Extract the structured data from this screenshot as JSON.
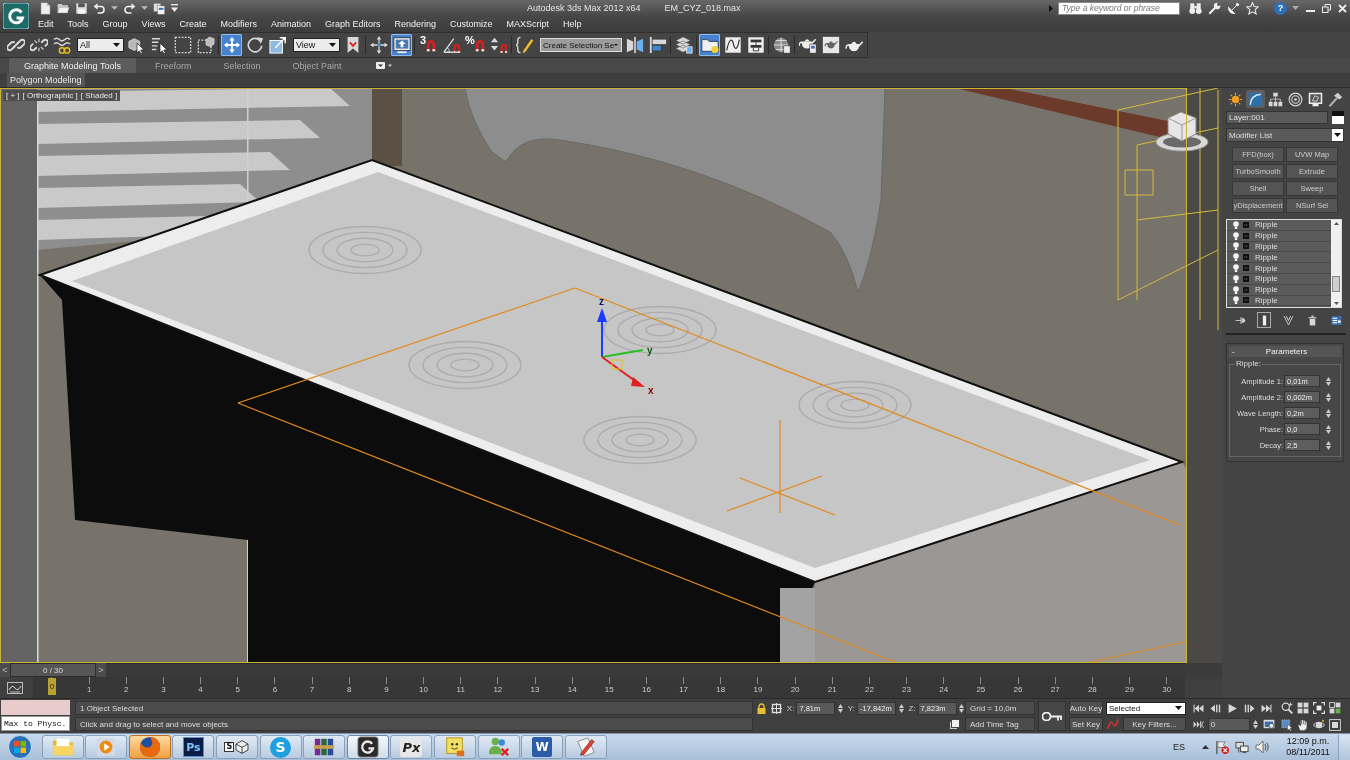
{
  "title_bar": {
    "title": "Autodesk 3ds Max 2012 x64",
    "file_name": "EM_CYZ_018.max",
    "search": {
      "placeholder": "Type a keyword or phrase"
    },
    "help": "?"
  },
  "menu_bar": [
    "Edit",
    "Tools",
    "Group",
    "Views",
    "Create",
    "Modifiers",
    "Animation",
    "Graph Editors",
    "Rendering",
    "Customize",
    "MAXScript",
    "Help"
  ],
  "main_toolbar": [
    {
      "kind": "button",
      "selected": false
    },
    {
      "kind": "button",
      "selected": false
    },
    {
      "kind": "button",
      "selected": false
    },
    {
      "kind": "dropdown",
      "value": "All"
    },
    {
      "kind": "button",
      "selected": false
    },
    {
      "kind": "button",
      "selected": false
    },
    {
      "kind": "button",
      "selected": false
    },
    {
      "kind": "button",
      "selected": false
    },
    {
      "kind": "separator"
    },
    {
      "kind": "button",
      "selected": true
    },
    {
      "kind": "button",
      "selected": false
    },
    {
      "kind": "button",
      "selected": false
    },
    {
      "kind": "dropdown",
      "value": "View"
    },
    {
      "kind": "button",
      "selected": false
    },
    {
      "kind": "separator"
    },
    {
      "kind": "button",
      "selected": false
    },
    {
      "kind": "button",
      "selected": true
    },
    {
      "kind": "separator"
    },
    {
      "kind": "button",
      "selected": false,
      "glyph": "3"
    },
    {
      "kind": "button",
      "selected": false
    },
    {
      "kind": "button",
      "selected": false,
      "glyph": "%"
    },
    {
      "kind": "button",
      "selected": false
    },
    {
      "kind": "separator"
    },
    {
      "kind": "button",
      "selected": false
    },
    {
      "kind": "dropdown",
      "value": "Create Selection Se"
    },
    {
      "kind": "button",
      "selected": false
    },
    {
      "kind": "button",
      "selected": false
    },
    {
      "kind": "separator"
    },
    {
      "kind": "button",
      "selected": false
    },
    {
      "kind": "separator"
    },
    {
      "kind": "button",
      "selected": true
    },
    {
      "kind": "button",
      "selected": false
    },
    {
      "kind": "button",
      "selected": false
    },
    {
      "kind": "separator"
    },
    {
      "kind": "button",
      "selected": false
    },
    {
      "kind": "separator"
    },
    {
      "kind": "button",
      "selected": false
    },
    {
      "kind": "button",
      "selected": false
    },
    {
      "kind": "button",
      "selected": false
    }
  ],
  "ribbon": {
    "tabs": [
      {
        "label": "Graphite Modeling Tools",
        "selected": true
      },
      {
        "label": "Freeform",
        "selected": false
      },
      {
        "label": "Selection",
        "selected": false
      },
      {
        "label": "Object Paint",
        "selected": false
      }
    ],
    "panels": [
      "Polygon Modeling"
    ]
  },
  "viewport": {
    "labels": [
      "[ + ]",
      "[ Orthographic ]",
      "[ Shaded ]"
    ],
    "gizmo_axes": [
      "z",
      "y",
      "x"
    ]
  },
  "command_panel": {
    "tabs": [
      {
        "selected": false
      },
      {
        "selected": true
      },
      {
        "selected": false
      },
      {
        "selected": false
      },
      {
        "selected": false
      },
      {
        "selected": false
      }
    ],
    "object_name": "Layer:001",
    "modifier_list": "Modifier List",
    "modifier_buttons": [
      "FFD(box)",
      "UVW Map",
      "TurboSmooth",
      "Extrude",
      "Shell",
      "Sweep",
      "yDisplacement",
      "NSurf Sel"
    ],
    "stack": [
      {
        "name": "Ripple",
        "on": true
      },
      {
        "name": "Ripple",
        "on": true
      },
      {
        "name": "Ripple",
        "on": true
      },
      {
        "name": "Ripple",
        "on": true
      },
      {
        "name": "Ripple",
        "on": true
      },
      {
        "name": "Ripple",
        "on": true
      },
      {
        "name": "Ripple",
        "on": true
      },
      {
        "name": "Ripple",
        "on": true
      }
    ],
    "stack_tools": [
      {
        "selected": false
      },
      {
        "selected": true
      },
      {
        "selected": false
      },
      {
        "selected": false
      },
      {
        "selected": false
      }
    ],
    "rollout": {
      "toggle": "-",
      "title": "Parameters",
      "group": "Ripple:",
      "params": [
        {
          "label": "Amplitude 1:",
          "value": "0,01m"
        },
        {
          "label": "Amplitude 2:",
          "value": "0,002m"
        },
        {
          "label": "Wave Length:",
          "value": "0,2m"
        },
        {
          "label": "Phase:",
          "value": "0,0"
        },
        {
          "label": "Decay:",
          "value": "2,5"
        }
      ]
    }
  },
  "time_slider": {
    "prev": "<",
    "label": "0 / 30",
    "next": ">"
  },
  "track_bar": {
    "ticks": [
      {
        "label": "0",
        "selected": true
      },
      {
        "label": "1",
        "selected": false
      },
      {
        "label": "2",
        "selected": false
      },
      {
        "label": "3",
        "selected": false
      },
      {
        "label": "4",
        "selected": false
      },
      {
        "label": "5",
        "selected": false
      },
      {
        "label": "6",
        "selected": false
      },
      {
        "label": "7",
        "selected": false
      },
      {
        "label": "8",
        "selected": false
      },
      {
        "label": "9",
        "selected": false
      },
      {
        "label": "10",
        "selected": false
      },
      {
        "label": "11",
        "selected": false
      },
      {
        "label": "12",
        "selected": false
      },
      {
        "label": "13",
        "selected": false
      },
      {
        "label": "14",
        "selected": false
      },
      {
        "label": "15",
        "selected": false
      },
      {
        "label": "16",
        "selected": false
      },
      {
        "label": "17",
        "selected": false
      },
      {
        "label": "18",
        "selected": false
      },
      {
        "label": "19",
        "selected": false
      },
      {
        "label": "20",
        "selected": false
      },
      {
        "label": "21",
        "selected": false
      },
      {
        "label": "22",
        "selected": false
      },
      {
        "label": "23",
        "selected": false
      },
      {
        "label": "24",
        "selected": false
      },
      {
        "label": "25",
        "selected": false
      },
      {
        "label": "26",
        "selected": false
      },
      {
        "label": "27",
        "selected": false
      },
      {
        "label": "28",
        "selected": false
      },
      {
        "label": "29",
        "selected": false
      },
      {
        "label": "30",
        "selected": false
      }
    ]
  },
  "status_bar": {
    "listener_output": "Max to Physc.",
    "selection": "1 Object Selected",
    "prompt": "Click and drag to select and move objects",
    "coordinates": [
      {
        "axis": "X:",
        "value": "7,81m"
      },
      {
        "axis": "Y:",
        "value": "-17,842m"
      },
      {
        "axis": "Z:",
        "value": "7,823m"
      }
    ],
    "grid": "Grid = 10,0m",
    "time_tag": "Add Time Tag"
  },
  "animation_controls": {
    "auto_key": "Auto Key",
    "key_mode": "Selected",
    "set_key": "Set Key",
    "key_filters": "Key Filters...",
    "current_frame": "0"
  },
  "taskbar": {
    "apps": [
      {
        "active": false,
        "flashing": false
      },
      {
        "active": false,
        "flashing": false
      },
      {
        "active": false,
        "flashing": true
      },
      {
        "active": false,
        "flashing": false,
        "glyph": "Ps"
      },
      {
        "active": false,
        "flashing": false,
        "glyph": "S"
      },
      {
        "active": false,
        "flashing": false,
        "glyph": "S"
      },
      {
        "active": false,
        "flashing": false
      },
      {
        "active": true,
        "flashing": false
      },
      {
        "active": false,
        "flashing": false,
        "glyph": "Px"
      },
      {
        "active": false,
        "flashing": false
      },
      {
        "active": false,
        "flashing": false
      },
      {
        "active": false,
        "flashing": false,
        "glyph": "W"
      },
      {
        "active": false,
        "flashing": false
      }
    ],
    "language": "ES",
    "time": "12:09 p.m.",
    "date": "08/11/2011"
  }
}
